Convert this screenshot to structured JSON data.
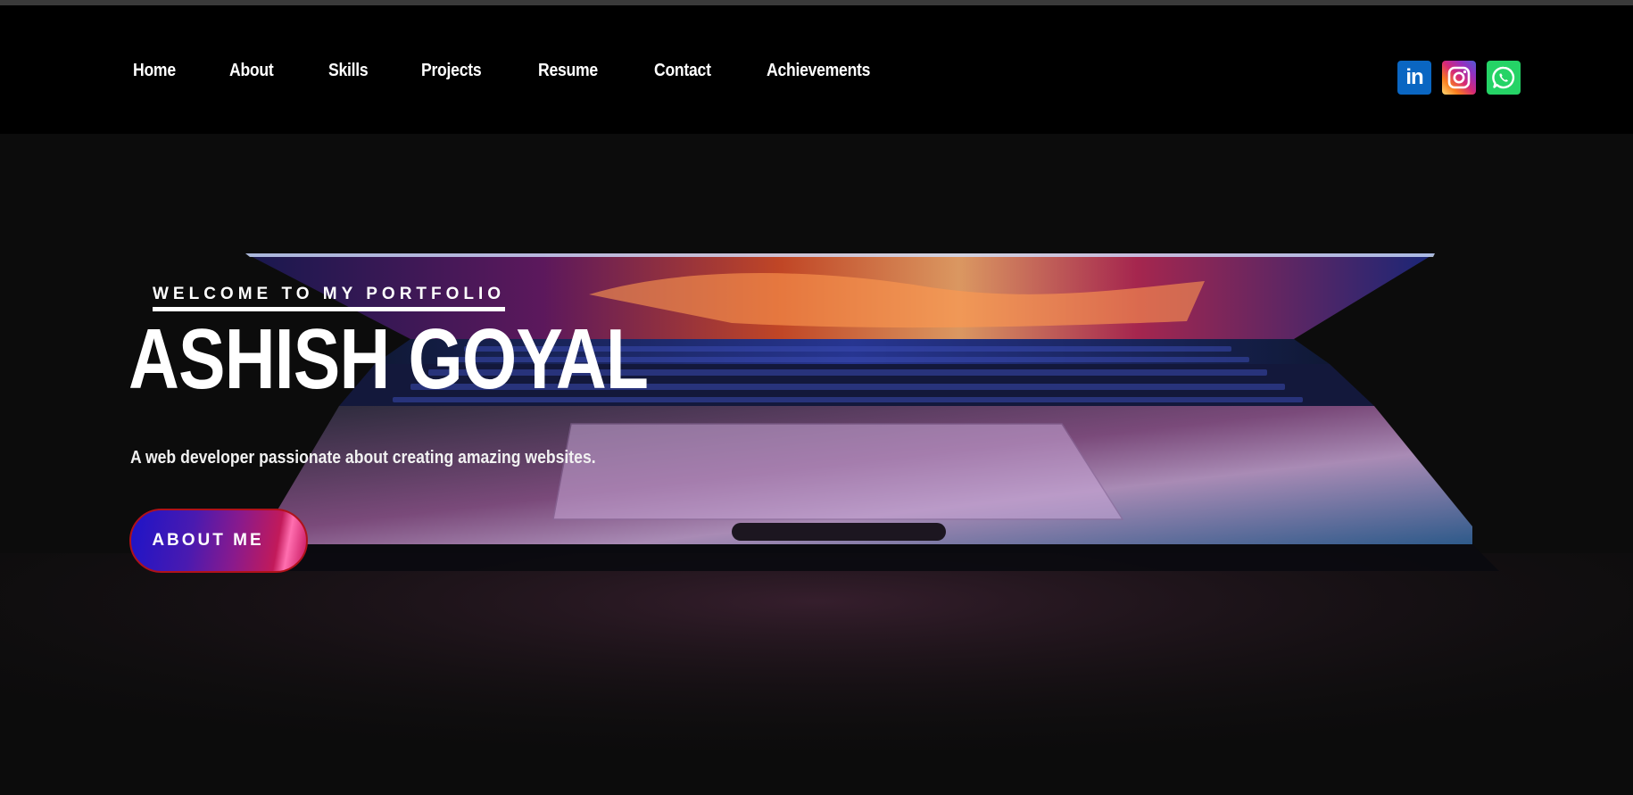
{
  "nav": {
    "links": [
      "Home",
      "About",
      "Skills",
      "Projects",
      "Resume",
      "Contact",
      "Achievements"
    ]
  },
  "social": {
    "linkedin": "in"
  },
  "hero": {
    "welcome": "WELCOME TO MY PORTFOLIO",
    "name": "ASHISH GOYAL",
    "tagline": "A web developer passionate about creating amazing websites.",
    "button": "ABOUT ME"
  },
  "colors": {
    "linkedin": "#0a66c2",
    "whatsapp": "#25d366",
    "button_border": "#b0121a"
  }
}
